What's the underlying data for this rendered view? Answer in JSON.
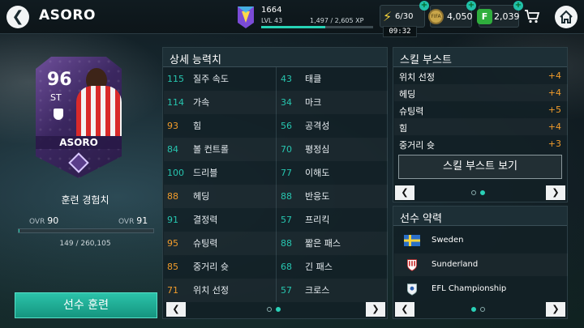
{
  "header": {
    "title": "ASORO",
    "xp_rating": "1664",
    "level": "LVL 43",
    "xp": "1,497 / 2,605 XP",
    "xp_progress": 0.575,
    "energy": "6/30",
    "timer": "09:32",
    "coins": "4,050",
    "coin_icon_label": "FIFA",
    "points": "2,039",
    "points_icon_label": "F"
  },
  "player_card": {
    "rating": "96",
    "position": "ST",
    "name": "ASORO"
  },
  "training": {
    "label": "훈련 경험치",
    "ovr_left_prefix": "OVR",
    "ovr_left": "90",
    "ovr_right_prefix": "OVR",
    "ovr_right": "91",
    "xp_text": "149 / 260,105",
    "progress": 0.0006,
    "button": "선수 훈련"
  },
  "attributes": {
    "title": "상세 능력치",
    "left": [
      {
        "value": "115",
        "label": "질주 속도",
        "color": "#27c6b0"
      },
      {
        "value": "114",
        "label": "가속",
        "color": "#27c6b0"
      },
      {
        "value": "93",
        "label": "힘",
        "color": "#f29c2b"
      },
      {
        "value": "84",
        "label": "볼 컨트롤",
        "color": "#27c6b0"
      },
      {
        "value": "100",
        "label": "드리블",
        "color": "#27c6b0"
      },
      {
        "value": "88",
        "label": "헤딩",
        "color": "#f29c2b"
      },
      {
        "value": "91",
        "label": "결정력",
        "color": "#27c6b0"
      },
      {
        "value": "95",
        "label": "슈팅력",
        "color": "#f29c2b"
      },
      {
        "value": "85",
        "label": "중거리 슛",
        "color": "#f29c2b"
      },
      {
        "value": "71",
        "label": "위치 선정",
        "color": "#f29c2b"
      }
    ],
    "right": [
      {
        "value": "43",
        "label": "태클",
        "color": "#27c6b0"
      },
      {
        "value": "34",
        "label": "마크",
        "color": "#27c6b0"
      },
      {
        "value": "56",
        "label": "공격성",
        "color": "#27c6b0"
      },
      {
        "value": "70",
        "label": "평정심",
        "color": "#27c6b0"
      },
      {
        "value": "77",
        "label": "이해도",
        "color": "#27c6b0"
      },
      {
        "value": "88",
        "label": "반응도",
        "color": "#27c6b0"
      },
      {
        "value": "57",
        "label": "프리킥",
        "color": "#27c6b0"
      },
      {
        "value": "88",
        "label": "짧은 패스",
        "color": "#27c6b0"
      },
      {
        "value": "68",
        "label": "긴 패스",
        "color": "#27c6b0"
      },
      {
        "value": "57",
        "label": "크로스",
        "color": "#27c6b0"
      }
    ],
    "prev": "❮",
    "next": "❯"
  },
  "skill_boost": {
    "title": "스킬 부스트",
    "items": [
      {
        "label": "위치 선정",
        "value": "+4"
      },
      {
        "label": "헤딩",
        "value": "+4"
      },
      {
        "label": "슈팅력",
        "value": "+5"
      },
      {
        "label": "힘",
        "value": "+4"
      },
      {
        "label": "중거리 슛",
        "value": "+3"
      }
    ],
    "button": "스킬 부스트 보기",
    "prev": "❮",
    "next": "❯"
  },
  "chemistry": {
    "title": "선수 약력",
    "items": [
      {
        "label": "Sweden",
        "icon": "sweden-flag-icon"
      },
      {
        "label": "Sunderland",
        "icon": "sunderland-crest-icon"
      },
      {
        "label": "EFL Championship",
        "icon": "efl-championship-icon"
      }
    ],
    "prev": "❮",
    "next": "❯"
  },
  "colors": {
    "accent": "#27d2b5",
    "orange": "#f29c2b"
  }
}
